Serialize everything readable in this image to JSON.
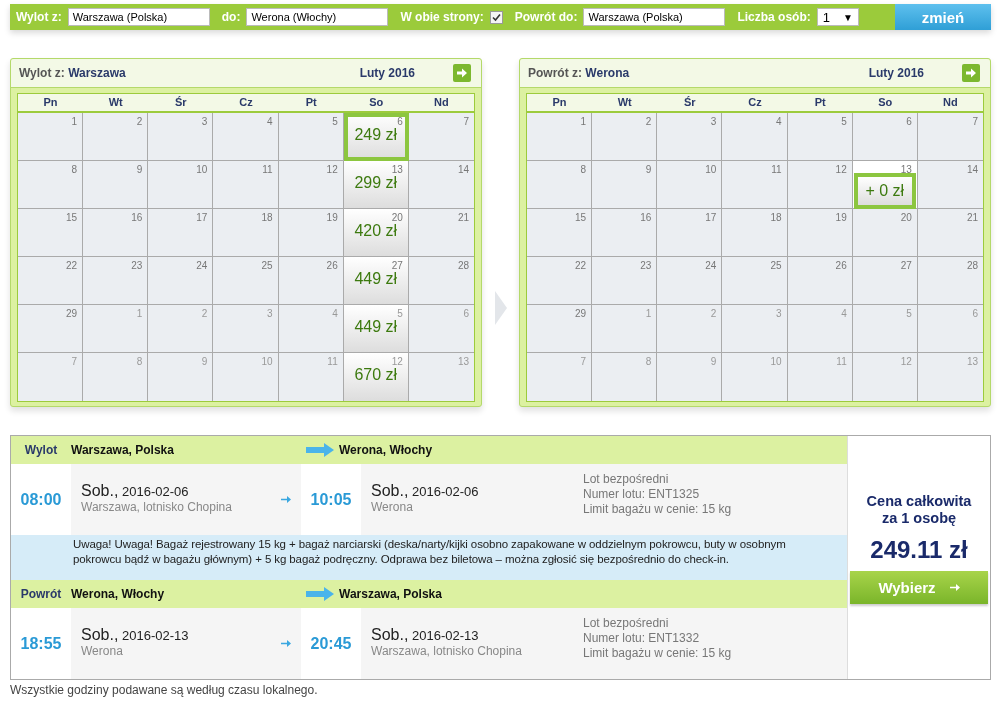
{
  "search_bar": {
    "items": [
      {
        "kind": "text",
        "label": "Wylot z:",
        "value": "Warszawa (Polska)"
      },
      {
        "kind": "text",
        "label": "do:",
        "value": "Werona (Włochy)"
      },
      {
        "kind": "checkbox",
        "label": "W obie strony:",
        "checked": true
      },
      {
        "kind": "text",
        "label": "Powrót do:",
        "value": "Warszawa (Polska)"
      },
      {
        "kind": "select",
        "label": "Liczba osób:",
        "value": "1",
        "caret": "▼"
      }
    ],
    "button": "zmień"
  },
  "calendars": [
    {
      "label": "Wylot z:",
      "city": "Warszawa",
      "month": "Luty 2016",
      "weekdays": [
        "Pn",
        "Wt",
        "Śr",
        "Cz",
        "Pt",
        "So",
        "Nd"
      ],
      "weeks": [
        [
          {
            "day": "1",
            "muted": false,
            "selected": false
          },
          {
            "day": "2",
            "muted": false,
            "selected": false
          },
          {
            "day": "3",
            "muted": false,
            "selected": false
          },
          {
            "day": "4",
            "muted": false,
            "selected": false
          },
          {
            "day": "5",
            "muted": false,
            "selected": false
          },
          {
            "day": "6",
            "muted": false,
            "selected": true,
            "price": "249 zł"
          },
          {
            "day": "7",
            "muted": false,
            "selected": false
          }
        ],
        [
          {
            "day": "8",
            "muted": false,
            "selected": false
          },
          {
            "day": "9",
            "muted": false,
            "selected": false
          },
          {
            "day": "10",
            "muted": false,
            "selected": false
          },
          {
            "day": "11",
            "muted": false,
            "selected": false
          },
          {
            "day": "12",
            "muted": false,
            "selected": false
          },
          {
            "day": "13",
            "muted": false,
            "selected": false,
            "price": "299 zł"
          },
          {
            "day": "14",
            "muted": false,
            "selected": false
          }
        ],
        [
          {
            "day": "15",
            "muted": false,
            "selected": false
          },
          {
            "day": "16",
            "muted": false,
            "selected": false
          },
          {
            "day": "17",
            "muted": false,
            "selected": false
          },
          {
            "day": "18",
            "muted": false,
            "selected": false
          },
          {
            "day": "19",
            "muted": false,
            "selected": false
          },
          {
            "day": "20",
            "muted": false,
            "selected": false,
            "price": "420 zł"
          },
          {
            "day": "21",
            "muted": false,
            "selected": false
          }
        ],
        [
          {
            "day": "22",
            "muted": false,
            "selected": false
          },
          {
            "day": "23",
            "muted": false,
            "selected": false
          },
          {
            "day": "24",
            "muted": false,
            "selected": false
          },
          {
            "day": "25",
            "muted": false,
            "selected": false
          },
          {
            "day": "26",
            "muted": false,
            "selected": false
          },
          {
            "day": "27",
            "muted": false,
            "selected": false,
            "price": "449 zł"
          },
          {
            "day": "28",
            "muted": false,
            "selected": false
          }
        ],
        [
          {
            "day": "29",
            "muted": false,
            "selected": false
          },
          {
            "day": "1",
            "muted": true,
            "selected": false
          },
          {
            "day": "2",
            "muted": true,
            "selected": false
          },
          {
            "day": "3",
            "muted": true,
            "selected": false
          },
          {
            "day": "4",
            "muted": true,
            "selected": false
          },
          {
            "day": "5",
            "muted": true,
            "selected": false,
            "price": "449 zł"
          },
          {
            "day": "6",
            "muted": true,
            "selected": false
          }
        ],
        [
          {
            "day": "7",
            "muted": true,
            "selected": false
          },
          {
            "day": "8",
            "muted": true,
            "selected": false
          },
          {
            "day": "9",
            "muted": true,
            "selected": false
          },
          {
            "day": "10",
            "muted": true,
            "selected": false
          },
          {
            "day": "11",
            "muted": true,
            "selected": false
          },
          {
            "day": "12",
            "muted": true,
            "selected": false,
            "price": "670 zł"
          },
          {
            "day": "13",
            "muted": true,
            "selected": false
          }
        ]
      ]
    },
    {
      "label": "Powrót z:",
      "city": "Werona",
      "month": "Luty 2016",
      "weekdays": [
        "Pn",
        "Wt",
        "Śr",
        "Cz",
        "Pt",
        "So",
        "Nd"
      ],
      "weeks": [
        [
          {
            "day": "1",
            "muted": false,
            "selected": false
          },
          {
            "day": "2",
            "muted": false,
            "selected": false
          },
          {
            "day": "3",
            "muted": false,
            "selected": false
          },
          {
            "day": "4",
            "muted": false,
            "selected": false
          },
          {
            "day": "5",
            "muted": false,
            "selected": false
          },
          {
            "day": "6",
            "muted": false,
            "selected": false
          },
          {
            "day": "7",
            "muted": false,
            "selected": false
          }
        ],
        [
          {
            "day": "8",
            "muted": false,
            "selected": false
          },
          {
            "day": "9",
            "muted": false,
            "selected": false
          },
          {
            "day": "10",
            "muted": false,
            "selected": false
          },
          {
            "day": "11",
            "muted": false,
            "selected": false
          },
          {
            "day": "12",
            "muted": false,
            "selected": false
          },
          {
            "day": "13",
            "muted": false,
            "selected": true,
            "price": "+ 0 zł"
          },
          {
            "day": "14",
            "muted": false,
            "selected": false
          }
        ],
        [
          {
            "day": "15",
            "muted": false,
            "selected": false
          },
          {
            "day": "16",
            "muted": false,
            "selected": false
          },
          {
            "day": "17",
            "muted": false,
            "selected": false
          },
          {
            "day": "18",
            "muted": false,
            "selected": false
          },
          {
            "day": "19",
            "muted": false,
            "selected": false
          },
          {
            "day": "20",
            "muted": false,
            "selected": false
          },
          {
            "day": "21",
            "muted": false,
            "selected": false
          }
        ],
        [
          {
            "day": "22",
            "muted": false,
            "selected": false
          },
          {
            "day": "23",
            "muted": false,
            "selected": false
          },
          {
            "day": "24",
            "muted": false,
            "selected": false
          },
          {
            "day": "25",
            "muted": false,
            "selected": false
          },
          {
            "day": "26",
            "muted": false,
            "selected": false
          },
          {
            "day": "27",
            "muted": false,
            "selected": false
          },
          {
            "day": "28",
            "muted": false,
            "selected": false
          }
        ],
        [
          {
            "day": "29",
            "muted": false,
            "selected": false
          },
          {
            "day": "1",
            "muted": true,
            "selected": false
          },
          {
            "day": "2",
            "muted": true,
            "selected": false
          },
          {
            "day": "3",
            "muted": true,
            "selected": false
          },
          {
            "day": "4",
            "muted": true,
            "selected": false
          },
          {
            "day": "5",
            "muted": true,
            "selected": false
          },
          {
            "day": "6",
            "muted": true,
            "selected": false
          }
        ],
        [
          {
            "day": "7",
            "muted": true,
            "selected": false
          },
          {
            "day": "8",
            "muted": true,
            "selected": false
          },
          {
            "day": "9",
            "muted": true,
            "selected": false
          },
          {
            "day": "10",
            "muted": true,
            "selected": false
          },
          {
            "day": "11",
            "muted": true,
            "selected": false
          },
          {
            "day": "12",
            "muted": true,
            "selected": false
          },
          {
            "day": "13",
            "muted": true,
            "selected": false
          }
        ]
      ]
    }
  ],
  "flights": [
    {
      "label": "Wylot",
      "from": "Warszawa, Polska",
      "to": "Werona, Włochy",
      "depart_time": "08:00",
      "depart_day": "Sob.,",
      "depart_date": "2016-02-06",
      "depart_place": "Warszawa, lotnisko Chopina",
      "arrive_time": "10:05",
      "arrive_day": "Sob.,",
      "arrive_date": "2016-02-06",
      "arrive_place": "Werona",
      "info": [
        "Lot bezpośredni",
        "Numer lotu: ENT1325",
        "Limit bagażu w cenie: 15 kg"
      ],
      "notice": "Uwaga! Uwaga! Bagaż rejestrowany 15 kg + bagaż narciarski (deska/narty/kijki osobno zapakowane w oddzielnym pokrowcu, buty w osobnym pokrowcu bądź w bagażu głównym) + 5 kg bagaż podręczny. Odprawa bez biletowa – można zgłosić się bezpośrednio do check-in."
    },
    {
      "label": "Powrót",
      "from": "Werona, Włochy",
      "to": "Warszawa, Polska",
      "depart_time": "18:55",
      "depart_day": "Sob.,",
      "depart_date": "2016-02-13",
      "depart_place": "Werona",
      "arrive_time": "20:45",
      "arrive_day": "Sob.,",
      "arrive_date": "2016-02-13",
      "arrive_place": "Warszawa, lotnisko Chopina",
      "info": [
        "Lot bezpośredni",
        "Numer lotu: ENT1332",
        "Limit bagażu w cenie: 15 kg"
      ]
    }
  ],
  "price": {
    "label_lines": [
      "Cena całkowita",
      "za 1 osobę"
    ],
    "amount": "249.11 zł",
    "button": "Wybierz"
  },
  "footer": "Wszystkie godziny podawane są według czasu lokalnego."
}
